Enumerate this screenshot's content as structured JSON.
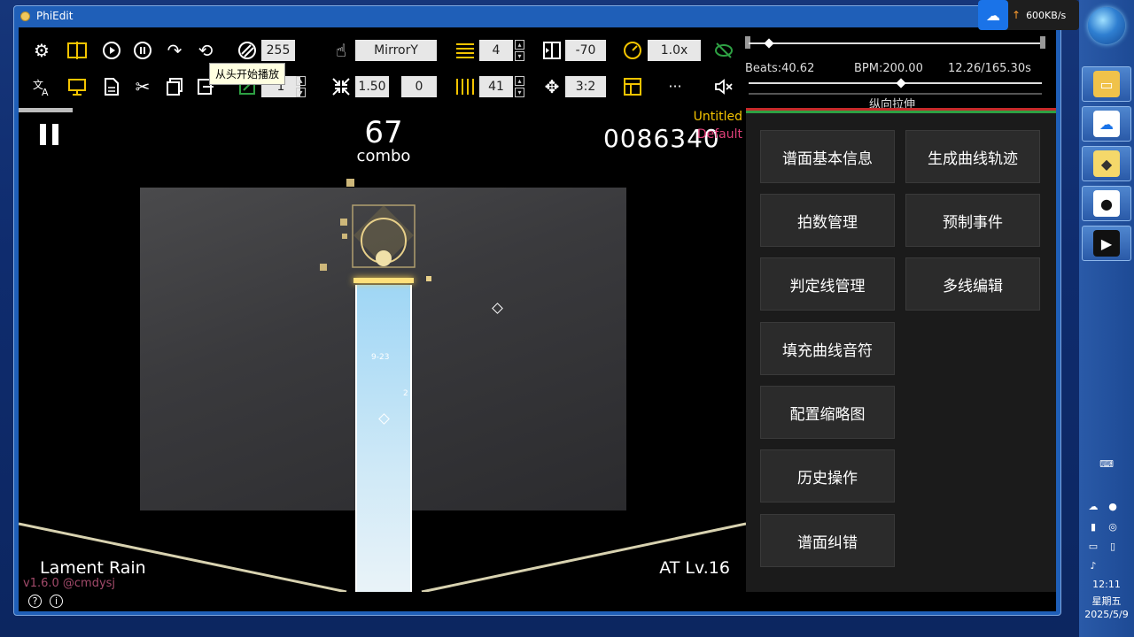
{
  "window": {
    "title": "PhiEdit"
  },
  "toolbar": {
    "row1": {
      "opacity_value": "255",
      "mirror_value": "MirrorY",
      "beat_div_value": "4",
      "offset_value": "-70",
      "speed_value": "1.0x"
    },
    "row2": {
      "line_value": "1",
      "scale_value": "1.50",
      "zero_value": "0",
      "count_value": "41",
      "ratio_value": "3:2",
      "more_label": "···"
    },
    "tooltip": "从头开始播放"
  },
  "timeline": {
    "beats": "Beats:40.62",
    "bpm": "BPM:200.00",
    "time": "12.26/165.30s",
    "stretch_label": "纵向拉伸",
    "position_fraction": 0.07,
    "stretch_fraction": 0.52
  },
  "game": {
    "combo_number": "67",
    "combo_label": "combo",
    "score": "0086340",
    "chart_name": "Untitled",
    "difficulty": "Default",
    "song_name": "Lament Rain",
    "level": "AT Lv.16",
    "version": "v1.6.0 @cmdysj",
    "lane_texts": [
      "9-23",
      "2"
    ]
  },
  "panel": {
    "buttons": [
      "谱面基本信息",
      "生成曲线轨迹",
      "拍数管理",
      "预制事件",
      "判定线管理",
      "多线编辑",
      "填充曲线音符",
      "配置缩略图",
      "历史操作",
      "谱面纠错"
    ]
  },
  "network": {
    "speed": "600KB/s"
  },
  "clock": {
    "time": "12:11",
    "weekday": "星期五",
    "date": "2025/5/9"
  },
  "colors": {
    "accent_yellow": "#f5c400",
    "panel_bg": "#1b1b1b",
    "difficulty_pink": "#e0407a"
  }
}
